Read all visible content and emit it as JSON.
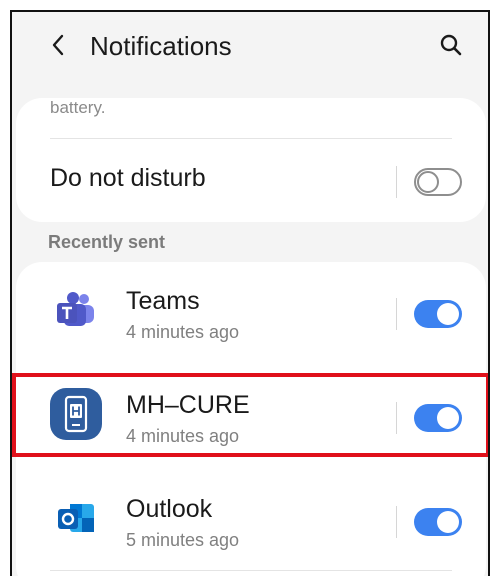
{
  "header": {
    "title": "Notifications",
    "back_icon": "chevron-left-icon",
    "search_icon": "search-icon"
  },
  "settings": {
    "truncated_text": "battery.",
    "do_not_disturb_label": "Do not disturb",
    "do_not_disturb_enabled": false
  },
  "recent": {
    "section_label": "Recently sent",
    "apps": [
      {
        "name": "Teams",
        "time": "4 minutes ago",
        "enabled": true,
        "icon": "teams-icon"
      },
      {
        "name": "MH–CURE",
        "time": "4 minutes ago",
        "enabled": true,
        "icon": "mh-cure-icon",
        "highlighted": true
      },
      {
        "name": "Outlook",
        "time": "5 minutes ago",
        "enabled": true,
        "icon": "outlook-icon"
      }
    ]
  },
  "colors": {
    "toggle_on": "#3c82f0",
    "highlight": "#e0101a",
    "background": "#f4f4f4"
  }
}
